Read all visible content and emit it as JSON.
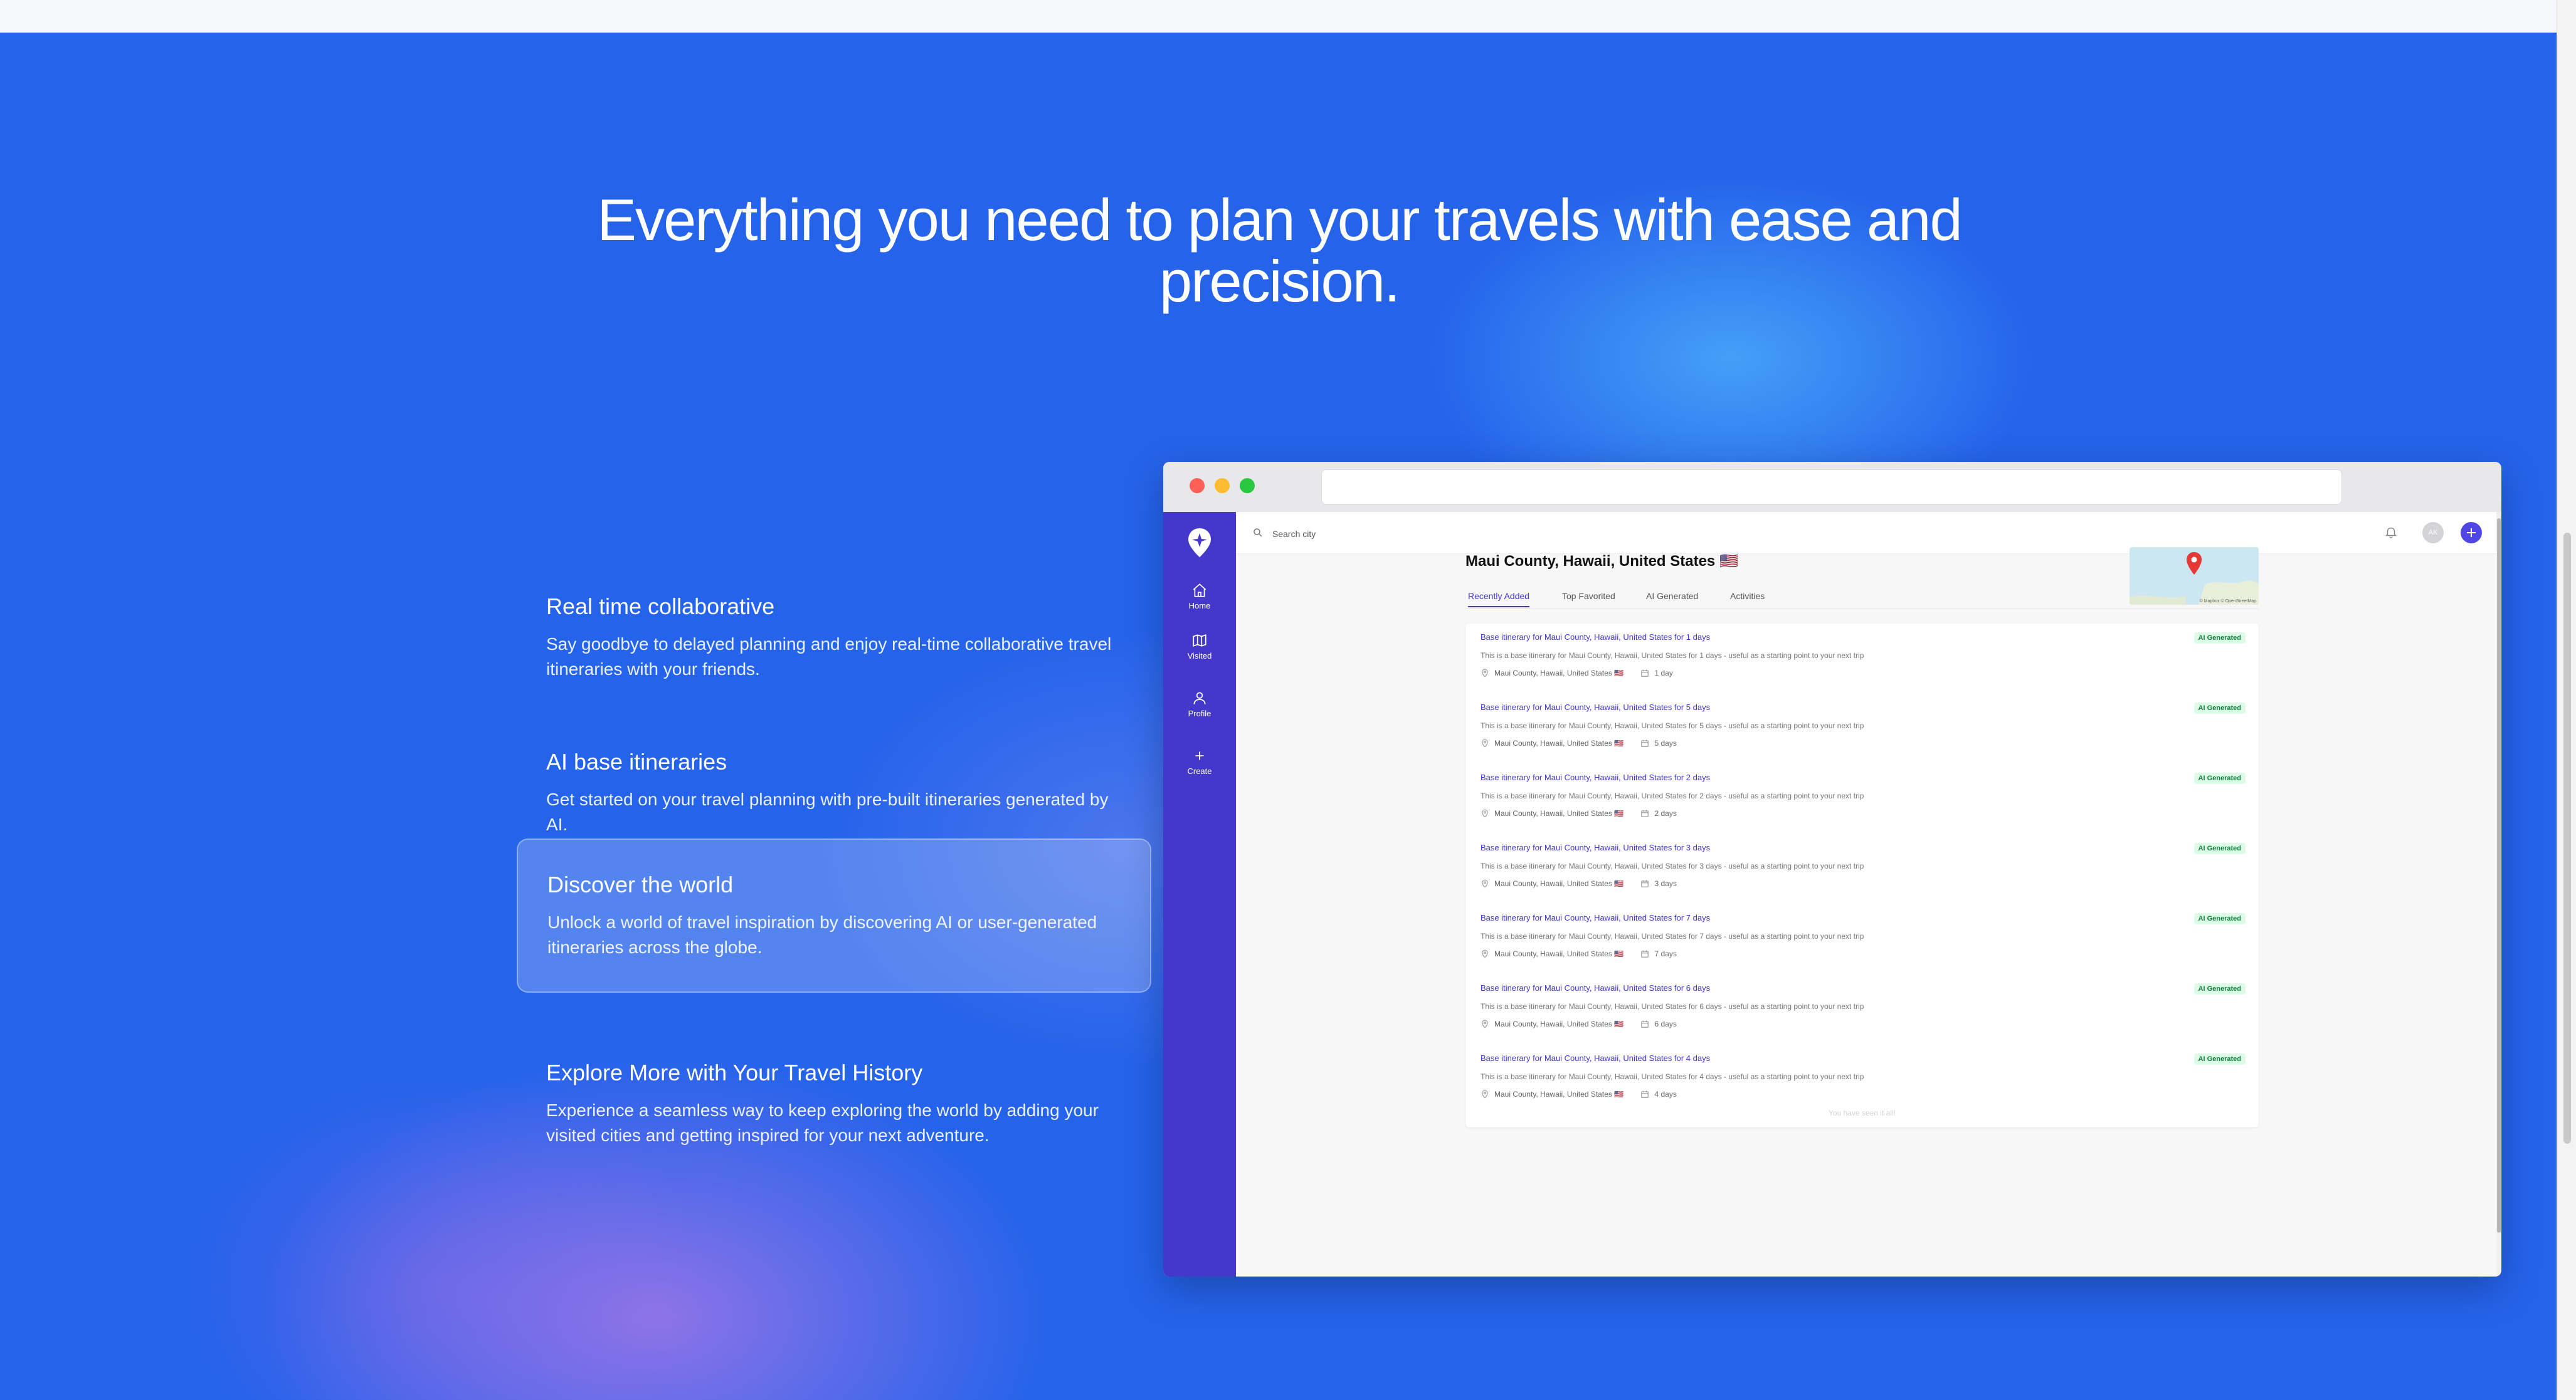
{
  "hero": {
    "headline": "Everything you need to plan your travels with ease and precision."
  },
  "features": [
    {
      "title": "Real time collaborative",
      "description": "Say goodbye to delayed planning and enjoy real-time collaborative travel itineraries with your friends.",
      "active": false
    },
    {
      "title": "AI base itineraries",
      "description": "Get started on your travel planning with pre-built itineraries generated by AI.",
      "active": false
    },
    {
      "title": "Discover the world",
      "description": "Unlock a world of travel inspiration by discovering AI or user-generated itineraries across the globe.",
      "active": true
    },
    {
      "title": "Explore More with Your Travel History",
      "description": "Experience a seamless way to keep exploring the world by adding your visited cities and getting inspired for your next adventure.",
      "active": false
    }
  ],
  "app": {
    "sidebar": {
      "items": [
        {
          "label": "Home",
          "icon": "home-icon"
        },
        {
          "label": "Visited",
          "icon": "map-icon"
        },
        {
          "label": "Profile",
          "icon": "user-icon"
        },
        {
          "label": "Create",
          "icon": "plus-icon"
        }
      ]
    },
    "header": {
      "search_placeholder": "Search city",
      "avatar_initials": "AK"
    },
    "city": {
      "title": "Maui County, Hawaii, United States 🇺🇸",
      "map_attribution": "© Mapbox © OpenStreetMap"
    },
    "tabs": [
      {
        "label": "Recently Added",
        "active": true
      },
      {
        "label": "Top Favorited",
        "active": false
      },
      {
        "label": "AI Generated",
        "active": false
      },
      {
        "label": "Activities",
        "active": false
      }
    ],
    "itineraries": [
      {
        "title": "Base itinerary for Maui County, Hawaii, United States for 1 days",
        "description": "This is a base itinerary for Maui County, Hawaii, United States for 1 days - useful as a starting point to your next trip",
        "location": "Maui County, Hawaii, United States 🇺🇸",
        "duration": "1 day",
        "badge": "AI Generated"
      },
      {
        "title": "Base itinerary for Maui County, Hawaii, United States for 5 days",
        "description": "This is a base itinerary for Maui County, Hawaii, United States for 5 days - useful as a starting point to your next trip",
        "location": "Maui County, Hawaii, United States 🇺🇸",
        "duration": "5 days",
        "badge": "AI Generated"
      },
      {
        "title": "Base itinerary for Maui County, Hawaii, United States for 2 days",
        "description": "This is a base itinerary for Maui County, Hawaii, United States for 2 days - useful as a starting point to your next trip",
        "location": "Maui County, Hawaii, United States 🇺🇸",
        "duration": "2 days",
        "badge": "AI Generated"
      },
      {
        "title": "Base itinerary for Maui County, Hawaii, United States for 3 days",
        "description": "This is a base itinerary for Maui County, Hawaii, United States for 3 days - useful as a starting point to your next trip",
        "location": "Maui County, Hawaii, United States 🇺🇸",
        "duration": "3 days",
        "badge": "AI Generated"
      },
      {
        "title": "Base itinerary for Maui County, Hawaii, United States for 7 days",
        "description": "This is a base itinerary for Maui County, Hawaii, United States for 7 days - useful as a starting point to your next trip",
        "location": "Maui County, Hawaii, United States 🇺🇸",
        "duration": "7 days",
        "badge": "AI Generated"
      },
      {
        "title": "Base itinerary for Maui County, Hawaii, United States for 6 days",
        "description": "This is a base itinerary for Maui County, Hawaii, United States for 6 days - useful as a starting point to your next trip",
        "location": "Maui County, Hawaii, United States 🇺🇸",
        "duration": "6 days",
        "badge": "AI Generated"
      },
      {
        "title": "Base itinerary for Maui County, Hawaii, United States for 4 days",
        "description": "This is a base itinerary for Maui County, Hawaii, United States for 4 days - useful as a starting point to your next trip",
        "location": "Maui County, Hawaii, United States 🇺🇸",
        "duration": "4 days",
        "badge": "AI Generated"
      }
    ],
    "end_of_list": "You have seen it all!"
  },
  "colors": {
    "hero_blue": "#2563eb",
    "sidebar_indigo": "#4338ca",
    "accent": "#4f46e5",
    "badge_green": "#15803d",
    "badge_green_bg": "#dcfce7",
    "traffic_red": "#ff5f57",
    "traffic_yellow": "#febc2e",
    "traffic_green": "#28c840"
  }
}
